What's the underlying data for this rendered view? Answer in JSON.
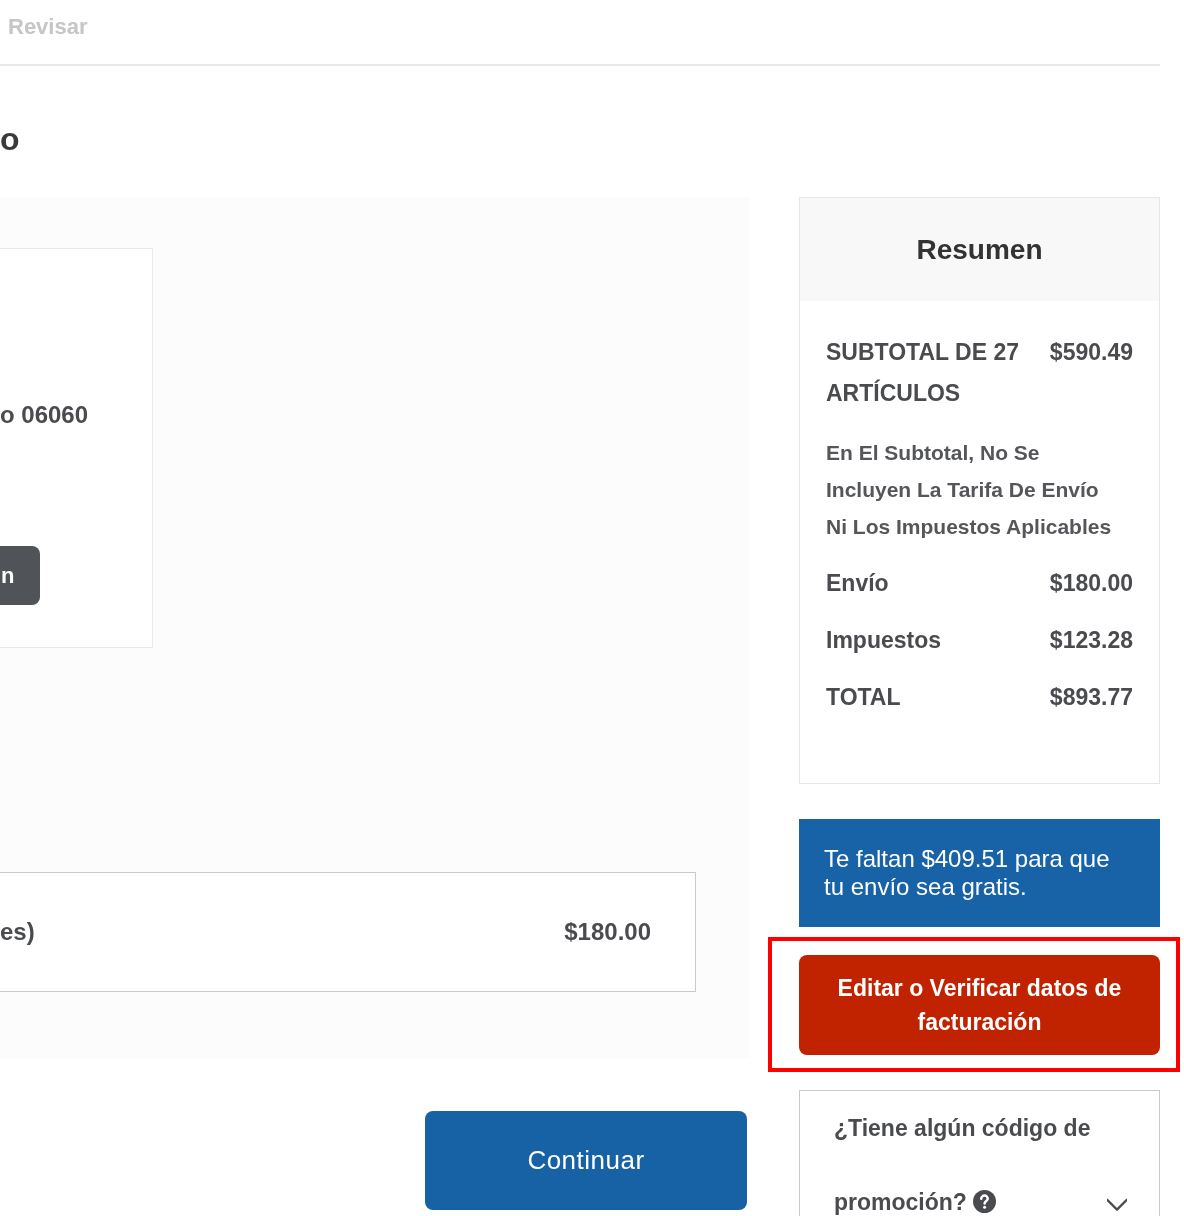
{
  "progress_steps": [
    {
      "label": "Revisar",
      "selected": false
    }
  ],
  "page_title": "o",
  "address_card": {
    "address_line": "o 06060",
    "button": "n"
  },
  "shipping_option": {
    "label": "es)",
    "price": "$180.00"
  },
  "continue_button": "Continuar",
  "summary": {
    "title": "Resumen",
    "subtotal": {
      "label": "SUBTOTAL DE 27 ARTÍCULOS",
      "amount": "$590.49"
    },
    "note": "En El Subtotal, No Se Incluyen La Tarifa De Envío Ni Los Impuestos Aplicables",
    "rows": [
      {
        "label": "Envío",
        "amount": "$180.00"
      },
      {
        "label": "Impuestos",
        "amount": "$123.28"
      },
      {
        "label": "TOTAL",
        "amount": "$893.77"
      }
    ]
  },
  "free_shipping_banner": "Te faltan $409.51 para que tu envío sea gratis.",
  "billing_button": {
    "label": "Editar o Verificar datos de facturación",
    "highlighted": true
  },
  "promo": {
    "label": "¿Tiene algún código de promoción?",
    "expanded": false
  }
}
